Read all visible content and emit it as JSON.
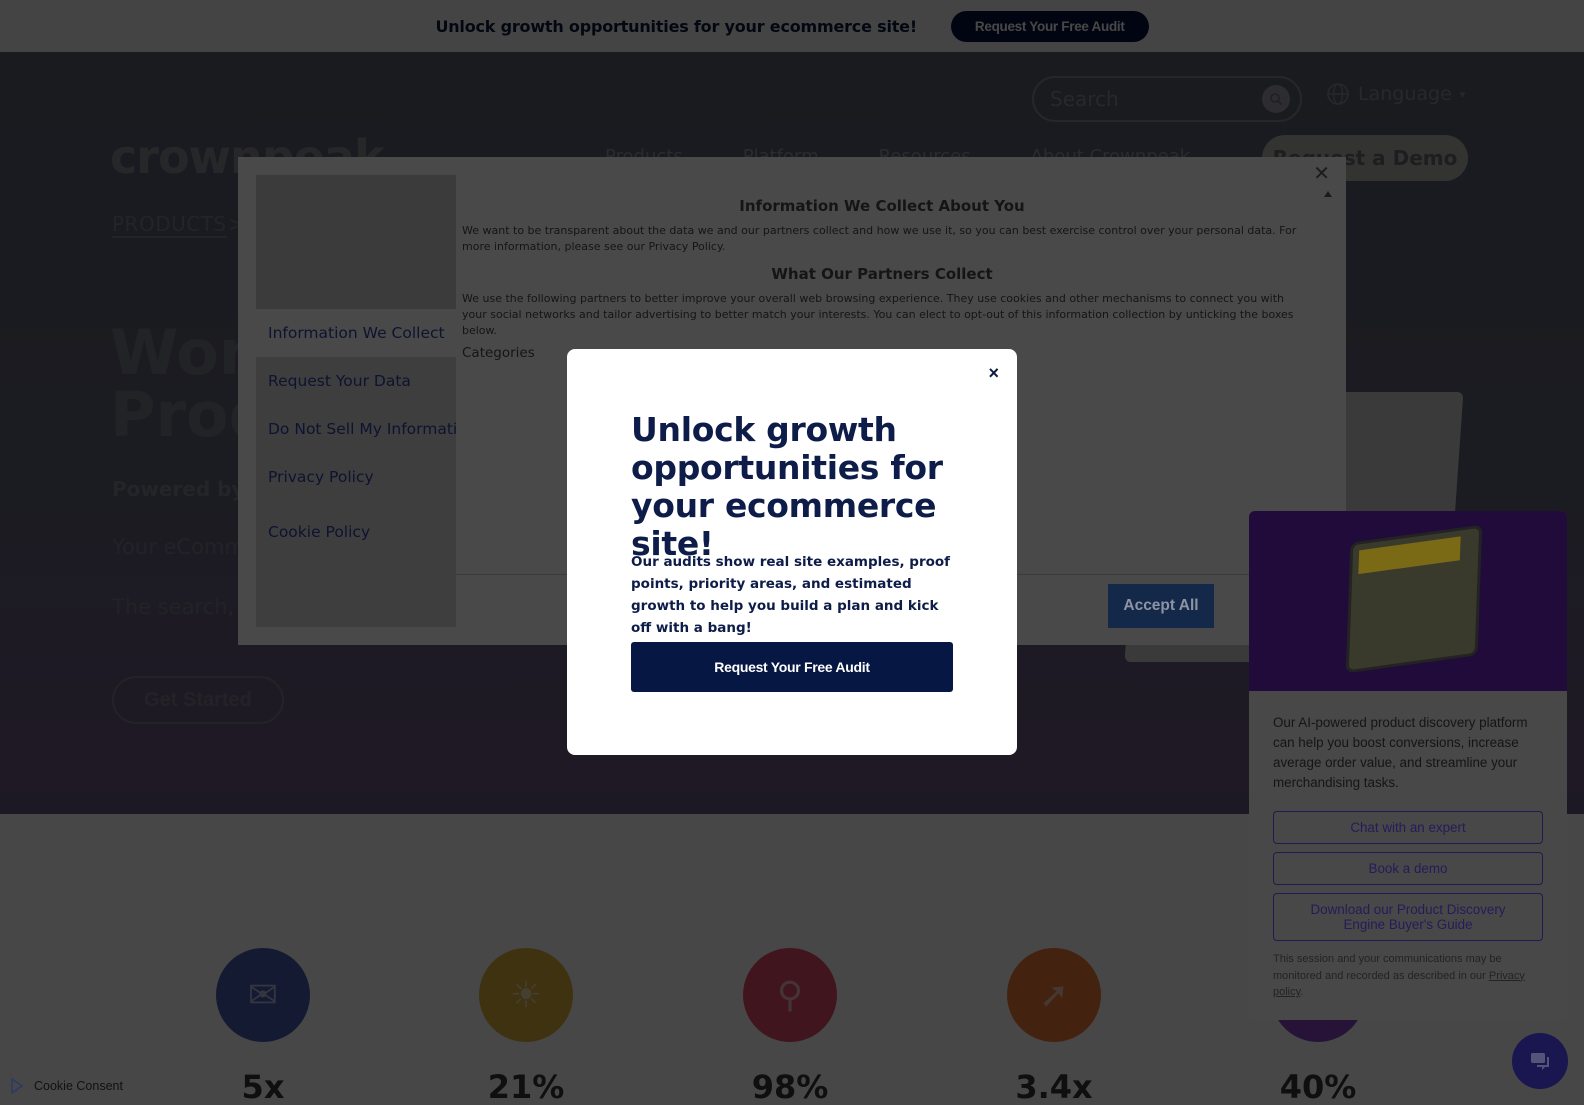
{
  "promo_bar": {
    "text": "Unlock growth opportunities for your ecommerce site!",
    "button_label": "Request Your Free Audit"
  },
  "header": {
    "logo_text": "crownpeak",
    "search": {
      "placeholder": "Search"
    },
    "language_label": "Language",
    "nav": [
      "Products",
      "Platform",
      "Resources",
      "About Crownpeak"
    ],
    "demo_button": "Request a Demo"
  },
  "hero": {
    "breadcrumb": "PRODUCTS",
    "breadcrumb_sep": ">",
    "title_line1": "World",
    "title_line2": "Produ",
    "powered_by": "Powered by F",
    "subtitle": "Your eComme",
    "description": "The search, m online revenue",
    "cta": "Get Started"
  },
  "stats": [
    {
      "icon": "chat-bubble-icon",
      "value": "5x",
      "color": "#4b5fb7"
    },
    {
      "icon": "lightbulb-icon",
      "value": "21%",
      "color": "#e3b33c"
    },
    {
      "icon": "magnifier-icon",
      "value": "98%",
      "color": "#e54b6d"
    },
    {
      "icon": "growth-arrow-icon",
      "value": "3.4x",
      "color": "#ef7a3c"
    },
    {
      "icon": "dial-icon",
      "value": "40%",
      "color": "#8d46c7"
    }
  ],
  "cookie_modal": {
    "sidebar": [
      "Information We Collect",
      "Request Your Data",
      "Do Not Sell My Information",
      "Privacy Policy",
      "Cookie Policy"
    ],
    "active_item": "Information We Collect",
    "heading1": "Information We Collect About You",
    "para1": "We want to be transparent about the data we and our partners collect and how we use it, so you can best exercise control over your personal data. For more information, please see our Privacy Policy.",
    "heading2": "What Our Partners Collect",
    "para2": "We use the following partners to better improve your overall web browsing experience. They use cookies and other mechanisms to connect you with your social networks and tailor advertising to better match your interests. You can elect to opt-out of this information collection by unticking the boxes below.",
    "categories_label": "Categories",
    "accept_all": "Accept All",
    "close_label": "×"
  },
  "audit_popup": {
    "title": "Unlock growth opportunities for your ecommerce site!",
    "description": "Our audits show real site examples, proof points, priority areas, and estimated growth to help you build a plan and kick off with a bang!",
    "cta": "Request Your Free Audit",
    "close_label": "×"
  },
  "chat_widget": {
    "intro": "Our AI-powered product discovery platform can help you boost conversions, increase average order value, and streamline your merchandising tasks.",
    "buttons": [
      "Chat with an expert",
      "Book a demo",
      "Download our Product Discovery Engine Buyer's Guide"
    ],
    "note_prefix": "This session and your communications may be monitored and recorded as described in our ",
    "note_link": "Privacy policy",
    "note_suffix": "."
  },
  "cookie_badge": {
    "label": "Cookie Consent"
  },
  "colors": {
    "brand_navy": "#071744",
    "chat_purple": "#3d1675",
    "overlay": "rgba(0,0,0,0.72)"
  }
}
